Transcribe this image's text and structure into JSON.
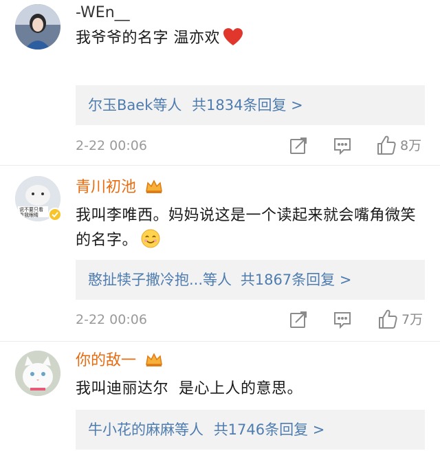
{
  "comments": [
    {
      "username": "-WEn__",
      "text": "我爷爷的名字 温亦欢",
      "reply_users": "尔玉Baek等人",
      "reply_count": "共1834条回复 >",
      "time": "2-22 00:06",
      "likes": "8万",
      "emoji": "red-heart",
      "vip": false
    },
    {
      "username": "青川初池",
      "text": "我叫李唯西。妈妈说这是一个读起来就会嘴角微笑的名字。",
      "avatar_caption": "说不要只看\n看我眼睛",
      "reply_users": "憨扯犊子撒冷抱...等人",
      "reply_count": "共1867条回复 >",
      "time": "2-22 00:06",
      "likes": "7万",
      "emoji": "smile",
      "vip": true
    },
    {
      "username": "你的敌一",
      "text": "我叫迪丽达尔  是心上人的意思。",
      "reply_users": "牛小花的麻麻等人",
      "reply_count": "共1746条回复 >",
      "vip": true
    }
  ],
  "colors": {
    "vip_name": "#e86b0f",
    "link": "#4f7cae",
    "meta": "#9a9a9a",
    "reply_bg": "#f2f2f2"
  }
}
